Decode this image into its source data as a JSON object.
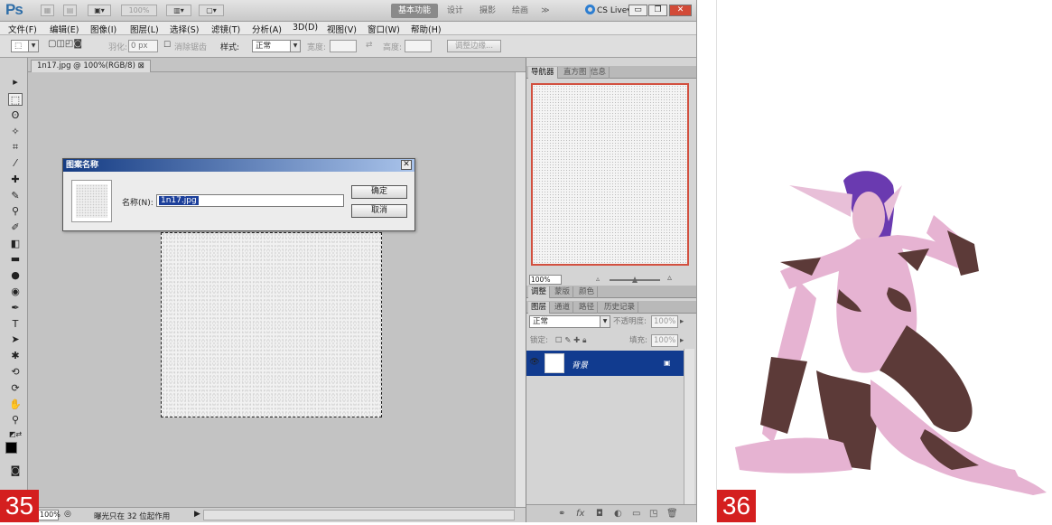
{
  "photoshop": {
    "logo": "Ps",
    "zoom_display": "100%",
    "workspaces": [
      "基本功能",
      "设计",
      "摄影",
      "绘画",
      "≫"
    ],
    "cs_live": "CS Live▾",
    "menus": [
      "文件(F)",
      "编辑(E)",
      "图像(I)",
      "图层(L)",
      "选择(S)",
      "滤镜(T)",
      "分析(A)",
      "3D(D)",
      "视图(V)",
      "窗口(W)",
      "帮助(H)"
    ],
    "options": {
      "feather_label": "羽化:",
      "feather_value": "0 px",
      "antialias_label": "消除锯齿",
      "style_label": "样式:",
      "style_value": "正常",
      "width_label": "宽度:",
      "height_label": "高度:",
      "refine_button": "调整边缘..."
    },
    "document_tab": "1n17.jpg @ 100%(RGB/8)",
    "dialog": {
      "title": "图案名称",
      "name_label": "名称(N):",
      "name_value": "1n17.jpg",
      "ok": "确定",
      "cancel": "取消"
    },
    "status": {
      "zoom": "100%",
      "message": "曝光只在 32 位起作用"
    },
    "panels": {
      "nav_tabs": [
        "导航器",
        "直方图",
        "信息"
      ],
      "nav_zoom": "100%",
      "adj_tabs": [
        "调整",
        "蒙版",
        "颜色"
      ],
      "layer_tabs": [
        "图层",
        "通道",
        "路径",
        "历史记录"
      ],
      "blend_mode": "正常",
      "opacity_label": "不透明度:",
      "opacity_value": "100%",
      "lock_label": "锁定:",
      "fill_label": "填充:",
      "fill_value": "100%",
      "layer_name": "背景"
    }
  },
  "figure_labels": [
    "35",
    "36"
  ]
}
